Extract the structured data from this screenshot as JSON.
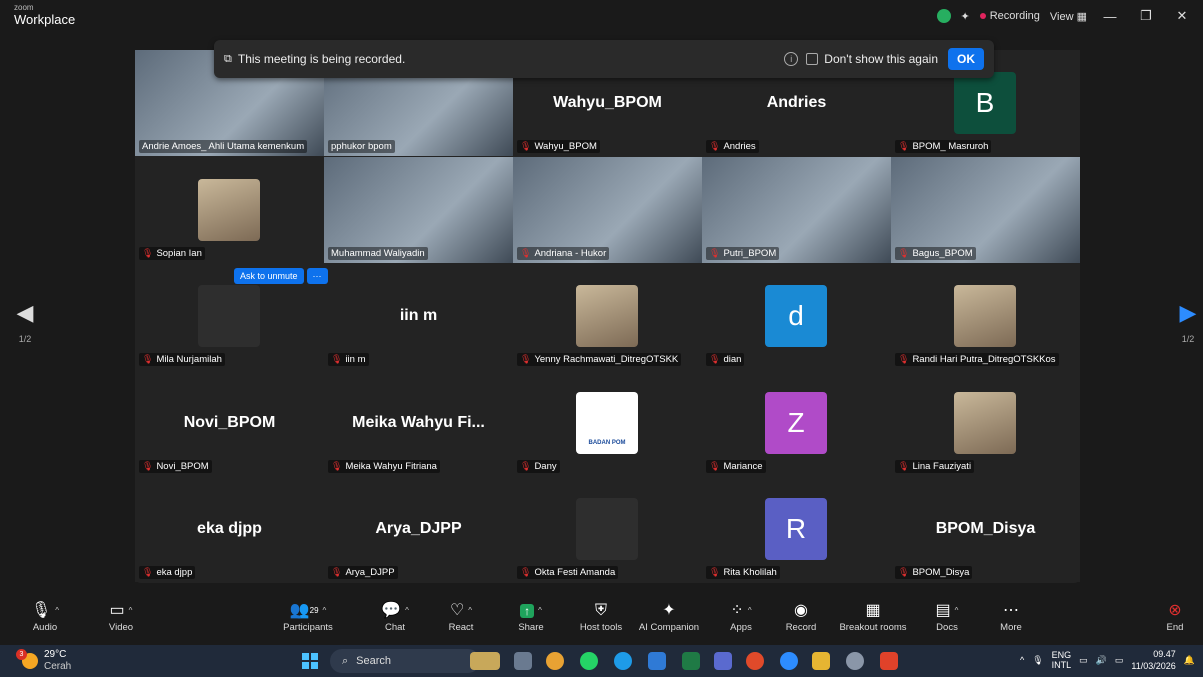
{
  "app": {
    "brand_small": "zoom",
    "brand_name": "Workplace",
    "recording_label": "Recording",
    "view_label": "View"
  },
  "notice": {
    "text": "This meeting is being recorded.",
    "dont_show": "Don't show this again",
    "ok": "OK"
  },
  "gallery": {
    "page_left": "1/2",
    "page_right": "1/2",
    "ask_to_unmute": "Ask to unmute",
    "more": "···",
    "tiles": [
      {
        "caption": "Andrie Amoes_ Ahli Utama kemenkum",
        "center": "",
        "type": "video",
        "muted": false
      },
      {
        "caption": "pphukor bpom",
        "center": "",
        "type": "video",
        "muted": false
      },
      {
        "caption": "Wahyu_BPOM",
        "center": "Wahyu_BPOM",
        "type": "name",
        "muted": true
      },
      {
        "caption": "Andries",
        "center": "Andries",
        "type": "name",
        "muted": true
      },
      {
        "caption": "BPOM_ Masruroh",
        "center": "",
        "type": "letter",
        "letter": "B",
        "color": "#0d4f3c",
        "muted": true
      },
      {
        "caption": "Sopian Ian",
        "center": "",
        "type": "photo",
        "muted": true
      },
      {
        "caption": "Muhammad Waliyadin",
        "center": "",
        "type": "video",
        "muted": false,
        "active": true
      },
      {
        "caption": "Andriana - Hukor",
        "center": "",
        "type": "video",
        "muted": true
      },
      {
        "caption": "Putri_BPOM",
        "center": "",
        "type": "video",
        "muted": true
      },
      {
        "caption": "Bagus_BPOM",
        "center": "",
        "type": "video",
        "muted": true
      },
      {
        "caption": "Mila Nurjamilah",
        "center": "",
        "type": "photo-dark",
        "muted": true
      },
      {
        "caption": "iin m",
        "center": "iin m",
        "type": "name",
        "muted": true
      },
      {
        "caption": "Yenny Rachmawati_DitregOTSKK",
        "center": "",
        "type": "photo",
        "muted": true
      },
      {
        "caption": "dian",
        "center": "",
        "type": "letter",
        "letter": "d",
        "color": "#1a8ad4",
        "muted": true
      },
      {
        "caption": "Randi Hari Putra_DitregOTSKKos",
        "center": "",
        "type": "photo",
        "muted": true
      },
      {
        "caption": "Novi_BPOM",
        "center": "Novi_BPOM",
        "type": "name",
        "muted": true
      },
      {
        "caption": "Meika Wahyu Fitriana",
        "center": "Meika Wahyu Fi...",
        "type": "name",
        "muted": true
      },
      {
        "caption": "Dany",
        "center": "",
        "type": "logo",
        "logo_text": "BADAN POM",
        "muted": true
      },
      {
        "caption": "Mariance",
        "center": "",
        "type": "letter",
        "letter": "Z",
        "color": "#b04bc8",
        "muted": true
      },
      {
        "caption": "Lina Fauziyati",
        "center": "",
        "type": "photo",
        "muted": true
      },
      {
        "caption": "eka djpp",
        "center": "eka djpp",
        "type": "name",
        "muted": true
      },
      {
        "caption": "Arya_DJPP",
        "center": "Arya_DJPP",
        "type": "name",
        "muted": true
      },
      {
        "caption": "Okta Festi Amanda",
        "center": "",
        "type": "photo-dark",
        "muted": true
      },
      {
        "caption": "Rita Kholilah",
        "center": "",
        "type": "letter",
        "letter": "R",
        "color": "#5a5fc4",
        "muted": true
      },
      {
        "caption": "BPOM_Disya",
        "center": "BPOM_Disya",
        "type": "name",
        "muted": true
      }
    ]
  },
  "toolbar": {
    "audio": "Audio",
    "video": "Video",
    "participants": "Participants",
    "participants_count": "29",
    "chat": "Chat",
    "react": "React",
    "share": "Share",
    "host_tools": "Host tools",
    "ai_companion": "AI Companion",
    "apps": "Apps",
    "record": "Record",
    "breakout": "Breakout rooms",
    "docs": "Docs",
    "more": "More",
    "end": "End"
  },
  "taskbar": {
    "temp": "29°C",
    "weather": "Cerah",
    "weather_badge": "3",
    "search": "Search",
    "lang": "ENG",
    "layout": "INTL",
    "time": "09.47",
    "date": "11/03/2026"
  },
  "colors": {
    "accent": "#0e72ed",
    "active_speaker": "#37c36f",
    "mute": "#e02f2f"
  }
}
